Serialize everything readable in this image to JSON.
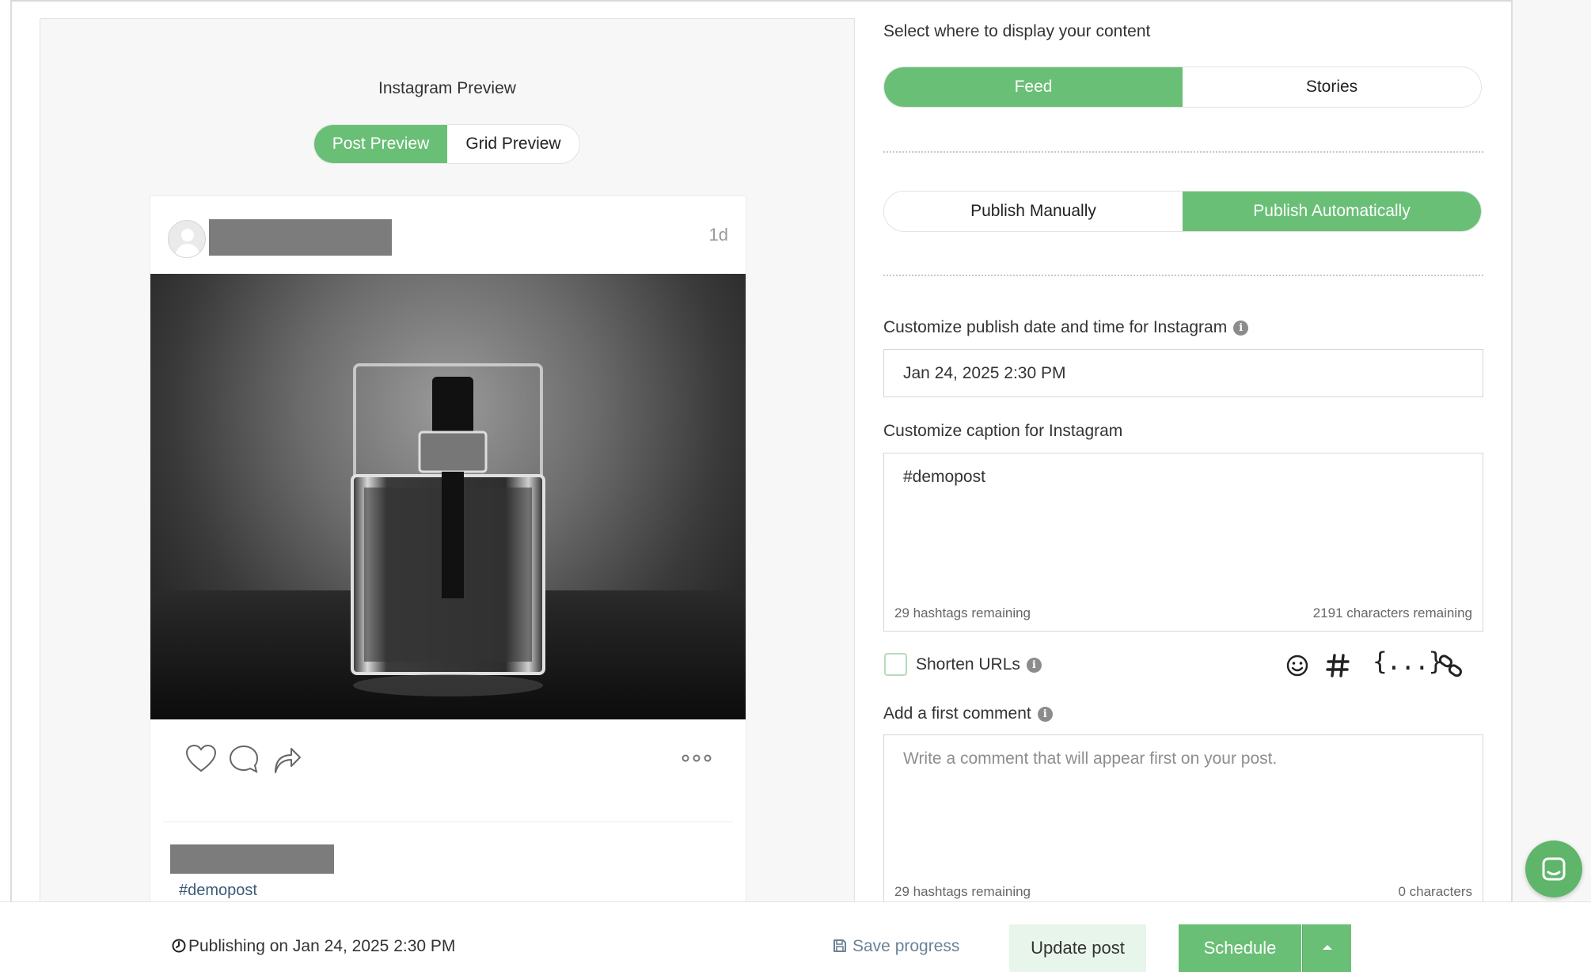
{
  "preview": {
    "title": "Instagram Preview",
    "tabs": [
      {
        "label": "Post Preview",
        "active": true
      },
      {
        "label": "Grid Preview",
        "active": false
      }
    ],
    "post": {
      "time": "1d",
      "caption_tag": "#demopost"
    }
  },
  "settings": {
    "display_label": "Select where to display your content",
    "placement_tabs": [
      {
        "label": "Feed",
        "active": true
      },
      {
        "label": "Stories",
        "active": false
      }
    ],
    "publish_tabs": [
      {
        "label": "Publish Manually",
        "active": false
      },
      {
        "label": "Publish Automatically",
        "active": true
      }
    ],
    "date_label": "Customize publish date and time for Instagram",
    "date_value": "Jan 24, 2025 2:30 PM",
    "caption_label": "Customize caption for Instagram",
    "caption_value": "#demopost",
    "caption_hashtags_remaining": "29 hashtags remaining",
    "caption_chars_remaining": "2191 characters remaining",
    "shorten_urls_label": "Shorten URLs",
    "shorten_urls_checked": false,
    "toolbar_icons": [
      "emoji-icon",
      "hashtag-icon",
      "variables-icon",
      "link-icon"
    ],
    "toolbar_variables_glyph": "{...}",
    "comment_label": "Add a first comment",
    "comment_placeholder": "Write a comment that will appear first on your post.",
    "comment_hashtags_remaining": "29 hashtags remaining",
    "comment_chars": "0 characters"
  },
  "bottom_bar": {
    "publishing_status": "Publishing on Jan 24, 2025 2:30 PM",
    "save_progress": "Save progress",
    "update_post": "Update post",
    "schedule": "Schedule"
  },
  "colors": {
    "accent": "#6abf76",
    "accent_light": "#e8f5ea",
    "link": "#3b5a78"
  }
}
